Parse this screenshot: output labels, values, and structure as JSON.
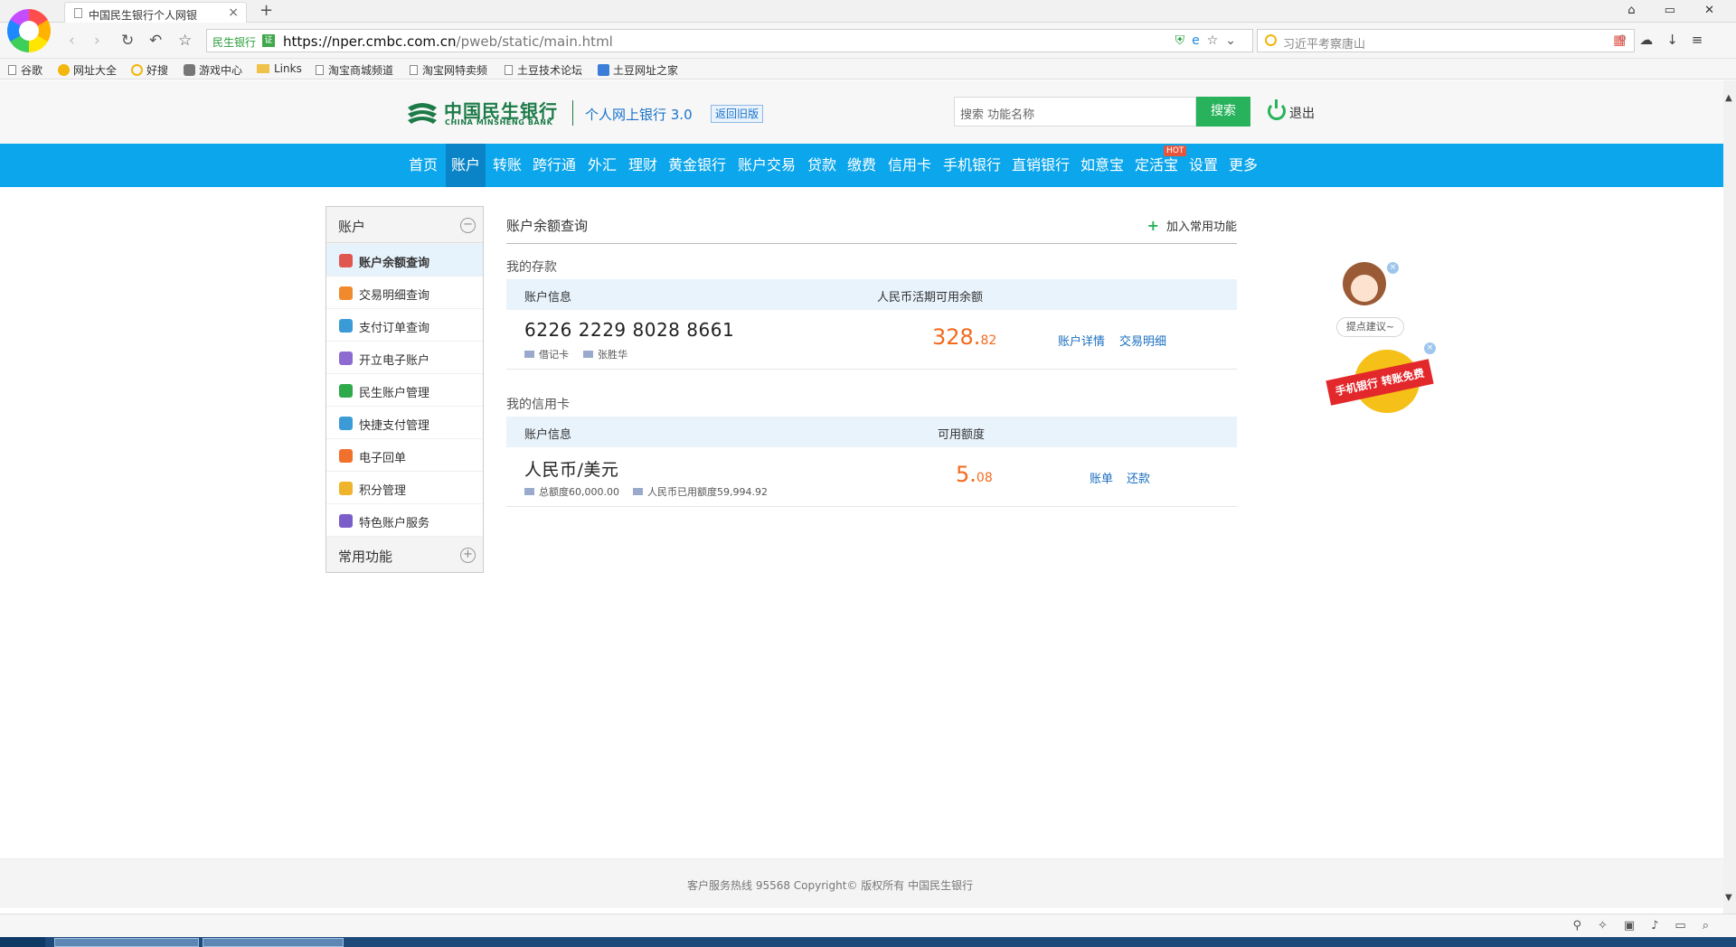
{
  "browser": {
    "tab_title": "中国民生银行个人网银",
    "tab_close": "×",
    "new_tab": "+",
    "window_controls": "⌂ ▭ ✕",
    "site_tag": "民生银行",
    "cert_label": "证",
    "url_host": "https://nper.cmbc.com.cn",
    "url_path": "/pweb/static/main.html",
    "search_placeholder": "习近平考察唐山",
    "bookmarks": [
      "谷歌",
      "网址大全",
      "好搜",
      "游戏中心",
      "Links",
      "淘宝商城频道",
      "淘宝网特卖频",
      "土豆技术论坛",
      "土豆网址之家"
    ]
  },
  "header": {
    "logo_cn": "中国民生银行",
    "logo_en": "CHINA MINSHENG BANK",
    "product": "个人网上银行 3.0",
    "old_version": "返回旧版",
    "search_placeholder": "搜索 功能名称",
    "search_button": "搜索",
    "logout": "退出"
  },
  "nav": {
    "items": [
      "首页",
      "账户",
      "转账",
      "跨行通",
      "外汇",
      "理财",
      "黄金银行",
      "账户交易",
      "贷款",
      "缴费",
      "信用卡",
      "手机银行",
      "直销银行",
      "如意宝",
      "定活宝",
      "设置",
      "更多"
    ],
    "active": "账户",
    "hot_badge": "HOT"
  },
  "sidebar": {
    "section_label": "账户",
    "section_toggle": "−",
    "items": [
      {
        "label": "账户余额查询",
        "icon": "balance-search-icon",
        "color": "#e0574f"
      },
      {
        "label": "交易明细查询",
        "icon": "transaction-detail-icon",
        "color": "#f08a2c"
      },
      {
        "label": "支付订单查询",
        "icon": "payment-order-icon",
        "color": "#3b9bd6"
      },
      {
        "label": "开立电子账户",
        "icon": "open-account-icon",
        "color": "#8e6bd1"
      },
      {
        "label": "民生账户管理",
        "icon": "account-manage-icon",
        "color": "#2faa4a"
      },
      {
        "label": "快捷支付管理",
        "icon": "quick-pay-icon",
        "color": "#3b9bd6"
      },
      {
        "label": "电子回单",
        "icon": "e-receipt-icon",
        "color": "#f0702c"
      },
      {
        "label": "积分管理",
        "icon": "points-icon",
        "color": "#f0b42c"
      },
      {
        "label": "特色账户服务",
        "icon": "special-service-icon",
        "color": "#7b5ec9"
      }
    ],
    "common_label": "常用功能",
    "common_toggle": "+"
  },
  "content": {
    "title": "账户余额查询",
    "add_favorite_icon": "+",
    "add_favorite": "加入常用功能",
    "deposits": {
      "section_title": "我的存款",
      "col_account": "账户信息",
      "col_balance": "人民币活期可用余额",
      "account_number": "6226 2229 8028 8661",
      "card_type": "借记卡",
      "holder": "张胜华",
      "balance_int": "328.",
      "balance_dec": "82",
      "link_detail": "账户详情",
      "link_transactions": "交易明细"
    },
    "credit": {
      "section_title": "我的信用卡",
      "col_account": "账户信息",
      "col_limit": "可用额度",
      "currency": "人民币/美元",
      "total_limit": "总额度60,000.00",
      "used_limit": "人民币已用额度59,994.92",
      "available_int": "5.",
      "available_dec": "08",
      "link_bill": "账单",
      "link_repay": "还款"
    }
  },
  "widgets": {
    "suggest": "提点建议~",
    "promo": "手机银行 转账免费",
    "close": "×"
  },
  "footer": {
    "text": "客户服务热线 95568 Copyright© 版权所有 中国民生银行"
  },
  "colors": {
    "brand_green": "#1d7b48",
    "nav_blue": "#0ba6ec",
    "nav_active": "#0a84c6",
    "amount_orange": "#f26a1b",
    "link_blue": "#1a6fc0",
    "search_green": "#27b25b"
  }
}
